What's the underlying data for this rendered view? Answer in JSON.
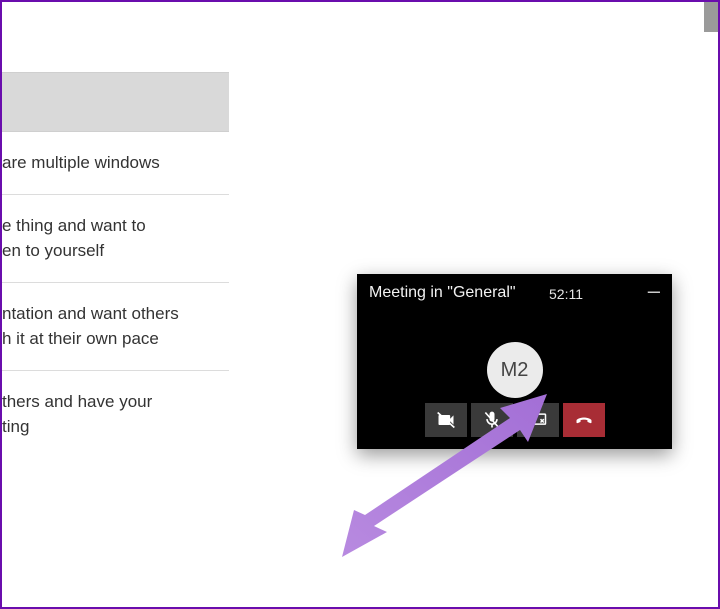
{
  "left_rows": {
    "r1": "are multiple windows",
    "r2a": "e thing and want to",
    "r2b": "en to yourself",
    "r3a": "ntation and want others",
    "r3b": "h it at their own pace",
    "r4a": "thers and have your",
    "r4b": "ting"
  },
  "pip": {
    "title": "Meeting in \"General\"",
    "duration": "52:11",
    "avatar_initials": "M2"
  }
}
